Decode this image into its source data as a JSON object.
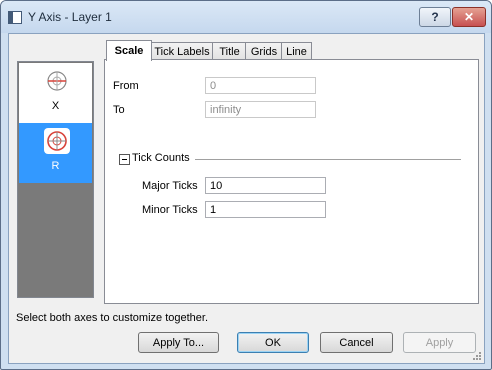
{
  "window": {
    "title": "Y Axis - Layer 1"
  },
  "titlebar": {
    "help_label": "?",
    "close_label": "✕"
  },
  "axes": [
    {
      "label": "X",
      "selected": false
    },
    {
      "label": "R",
      "selected": true
    }
  ],
  "tabs": [
    {
      "label": "Scale",
      "active": true
    },
    {
      "label": "Tick Labels",
      "active": false
    },
    {
      "label": "Title",
      "active": false
    },
    {
      "label": "Grids",
      "active": false
    },
    {
      "label": "Line",
      "active": false
    }
  ],
  "scale": {
    "from_label": "From",
    "from_value": "0",
    "to_label": "To",
    "to_value": "infinity",
    "tick_counts_label": "Tick Counts",
    "major_label": "Major Ticks",
    "major_value": "10",
    "minor_label": "Minor Ticks",
    "minor_value": "1"
  },
  "hint": "Select both axes to customize together.",
  "buttons": {
    "apply_to": "Apply To...",
    "ok": "OK",
    "cancel": "Cancel",
    "apply": "Apply"
  },
  "colors": {
    "selection": "#3399ff",
    "close": "#c75050",
    "axis_icon": "#d9433a"
  }
}
